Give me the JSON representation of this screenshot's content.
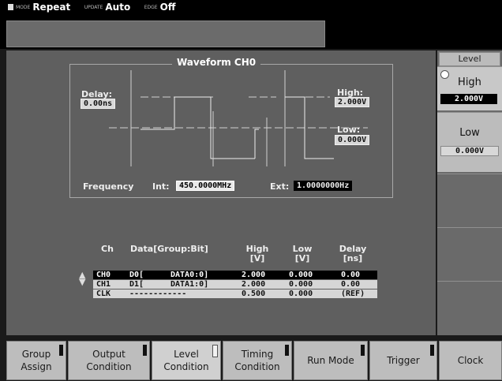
{
  "status": {
    "mode_label": "MODE",
    "mode_value": "Repeat",
    "update_label": "UPDATE",
    "update_value": "Auto",
    "edge_label": "EDGE",
    "edge_value": "Off"
  },
  "waveform": {
    "title": "Waveform CH0",
    "delay_label": "Delay:",
    "delay_value": "0.00ns",
    "high_label": "High:",
    "high_value": "2.000V",
    "low_label": "Low:",
    "low_value": "0.000V",
    "frequency_label": "Frequency",
    "int_label": "Int:",
    "int_value": "450.0000MHz",
    "ext_label": "Ext:",
    "ext_value": "1.0000000Hz"
  },
  "table": {
    "headers": {
      "ch": "Ch",
      "data": "Data[Group:Bit]",
      "high": "High",
      "high_unit": "[V]",
      "low": "Low",
      "low_unit": "[V]",
      "delay": "Delay",
      "delay_unit": "[ns]"
    },
    "rows": [
      {
        "ch": "CH0",
        "d": "D0[",
        "group": "DATA0:0]",
        "high": "2.000",
        "low": "0.000",
        "delay": "0.00"
      },
      {
        "ch": "CH1",
        "d": "D1[",
        "group": "DATA1:0]",
        "high": "2.000",
        "low": "0.000",
        "delay": "0.00"
      },
      {
        "ch": "CLK",
        "d": "------------",
        "group": "",
        "high": "0.500",
        "low": "0.000",
        "delay": "(REF)"
      }
    ]
  },
  "side_menu": {
    "header": "Level",
    "high_label": "High",
    "high_value": "2.000V",
    "low_label": "Low",
    "low_value": "0.000V"
  },
  "softkeys": [
    {
      "line1": "Group",
      "line2": "Assign"
    },
    {
      "line1": "Output",
      "line2": "Condition"
    },
    {
      "line1": "Level",
      "line2": "Condition"
    },
    {
      "line1": "Timing",
      "line2": "Condition"
    },
    {
      "line1": "Run Mode",
      "line2": ""
    },
    {
      "line1": "Trigger",
      "line2": ""
    },
    {
      "line1": "Clock",
      "line2": ""
    }
  ]
}
